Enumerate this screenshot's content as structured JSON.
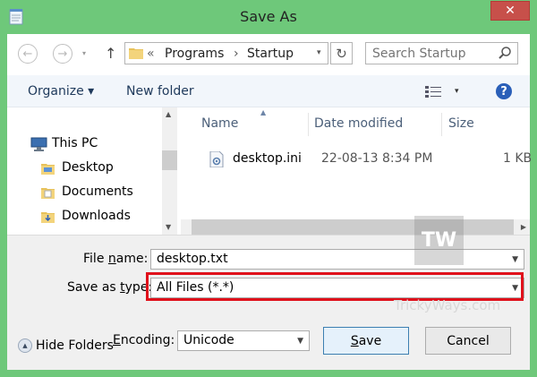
{
  "window": {
    "title": "Save As",
    "close_glyph": "✕"
  },
  "nav": {
    "back_glyph": "←",
    "forward_glyph": "→",
    "down_glyph": "▾",
    "up_glyph": "↑"
  },
  "address": {
    "sep_first": "«",
    "crumbs": [
      "Programs",
      "Startup"
    ],
    "crumb_sep": "›",
    "dropdown_glyph": "▾",
    "refresh_glyph": "↻"
  },
  "search": {
    "placeholder": "Search Startup"
  },
  "toolbar": {
    "organize": "Organize ▾",
    "new_folder": "New folder",
    "view_dropdown": "▾",
    "help": "?"
  },
  "nav_pane": {
    "items": [
      {
        "label": "This PC",
        "icon": "computer-icon"
      },
      {
        "label": "Desktop",
        "icon": "folder-icon"
      },
      {
        "label": "Documents",
        "icon": "folder-icon"
      },
      {
        "label": "Downloads",
        "icon": "folder-icon"
      }
    ]
  },
  "file_list": {
    "columns": [
      "Name",
      "Date modified",
      "Size"
    ],
    "rows": [
      {
        "name": "desktop.ini",
        "date": "22-08-13 8:34 PM",
        "size": "1 KB",
        "icon": "settings-file-icon"
      }
    ]
  },
  "form": {
    "file_name_label_pre": "File ",
    "file_name_label_u": "n",
    "file_name_label_post": "ame:",
    "file_name_value": "desktop.txt",
    "save_type_label_pre": "Save as ",
    "save_type_label_u": "t",
    "save_type_label_post": "ype:",
    "save_type_value": "All Files  (*.*)",
    "encoding_label_pre": "",
    "encoding_label_u": "E",
    "encoding_label_post": "ncoding:",
    "encoding_value": "Unicode",
    "hide_folders": "Hide Folders",
    "hide_glyph": "▲"
  },
  "buttons": {
    "save_u": "S",
    "save_rest": "ave",
    "cancel": "Cancel"
  },
  "watermark": {
    "logo": "TW",
    "site": "TrickyWays.com"
  },
  "colors": {
    "frame": "#6ec87a",
    "close": "#c7504a",
    "highlight": "#e0101b",
    "link": "#1e395b"
  }
}
